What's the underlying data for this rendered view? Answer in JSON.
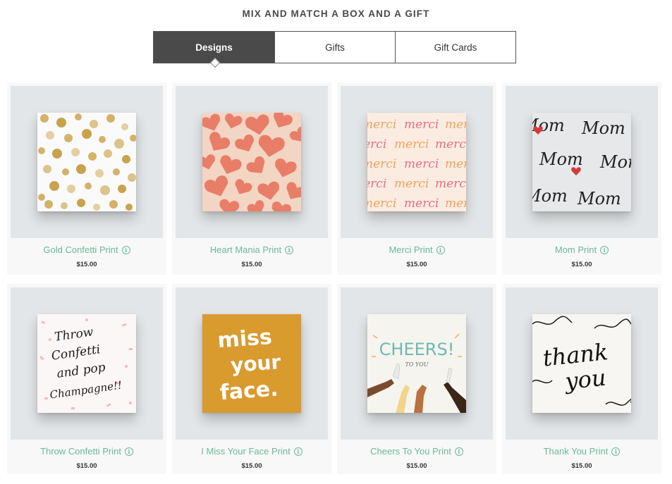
{
  "header": {
    "title": "MIX AND MATCH A BOX AND A GIFT"
  },
  "tabs": [
    {
      "label": "Designs",
      "active": true
    },
    {
      "label": "Gifts",
      "active": false
    },
    {
      "label": "Gift Cards",
      "active": false
    }
  ],
  "products": [
    {
      "name": "Gold Confetti Print",
      "price": "$15.00"
    },
    {
      "name": "Heart Mania Print",
      "price": "$15.00"
    },
    {
      "name": "Merci Print",
      "price": "$15.00",
      "art_text": "merci"
    },
    {
      "name": "Mom Print",
      "price": "$15.00",
      "art_text": "Mom"
    },
    {
      "name": "Throw Confetti Print",
      "price": "$15.00",
      "art_lines": [
        "Throw",
        "Confetti",
        "and pop",
        "Champagne!!"
      ]
    },
    {
      "name": "I Miss Your Face Print",
      "price": "$15.00",
      "art_lines": [
        "miss",
        "your",
        "face."
      ]
    },
    {
      "name": "Cheers To You Print",
      "price": "$15.00",
      "art_lines": [
        "CHEERS!",
        "TO YOU"
      ]
    },
    {
      "name": "Thank You Print",
      "price": "$15.00",
      "art_lines": [
        "thank",
        "you"
      ]
    }
  ],
  "colors": {
    "accent": "#6ab99a",
    "tab_active_bg": "#4a4a4a",
    "card_bg": "#f8f8f8",
    "photo_bg": "#e3e6e8"
  },
  "icons": {
    "info": "info-icon"
  }
}
